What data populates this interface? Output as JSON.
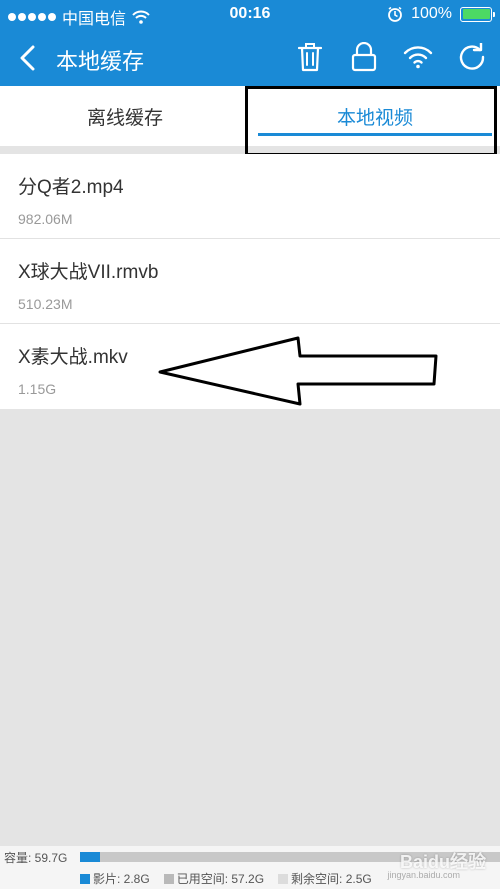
{
  "status_bar": {
    "carrier": "中国电信",
    "time": "00:16",
    "battery_text": "100%",
    "battery_level": 1.0,
    "icons": [
      "signal-dots-icon",
      "wifi-icon",
      "alarm-icon",
      "battery-icon"
    ]
  },
  "nav": {
    "title": "本地缓存",
    "back_icon": "chevron-left-icon",
    "actions": [
      "trash-icon",
      "lock-icon",
      "wifi-icon",
      "refresh-icon"
    ]
  },
  "tabs": [
    {
      "label": "离线缓存",
      "active": false
    },
    {
      "label": "本地视频",
      "active": true
    }
  ],
  "files": [
    {
      "name": "分Q者2.mp4",
      "size": "982.06M"
    },
    {
      "name": "X球大战VII.rmvb",
      "size": "510.23M"
    },
    {
      "name": "X素大战.mkv",
      "size": "1.15G"
    }
  ],
  "storage": {
    "capacity": "容量: 59.7G",
    "movies_used_fraction": 0.047,
    "legend": [
      {
        "label": "影片: 2.8G",
        "color": "#1a8ad6"
      },
      {
        "label": "已用空间: 57.2G",
        "color": "#b9b9b9"
      },
      {
        "label": "剩余空间: 2.5G",
        "color": "#dcdcdc"
      }
    ]
  },
  "watermark": {
    "text": "Baidu经验",
    "sub": "jingyan.baidu.com"
  },
  "colors": {
    "primary": "#1a8ad6",
    "battery_green": "#4cd964"
  }
}
